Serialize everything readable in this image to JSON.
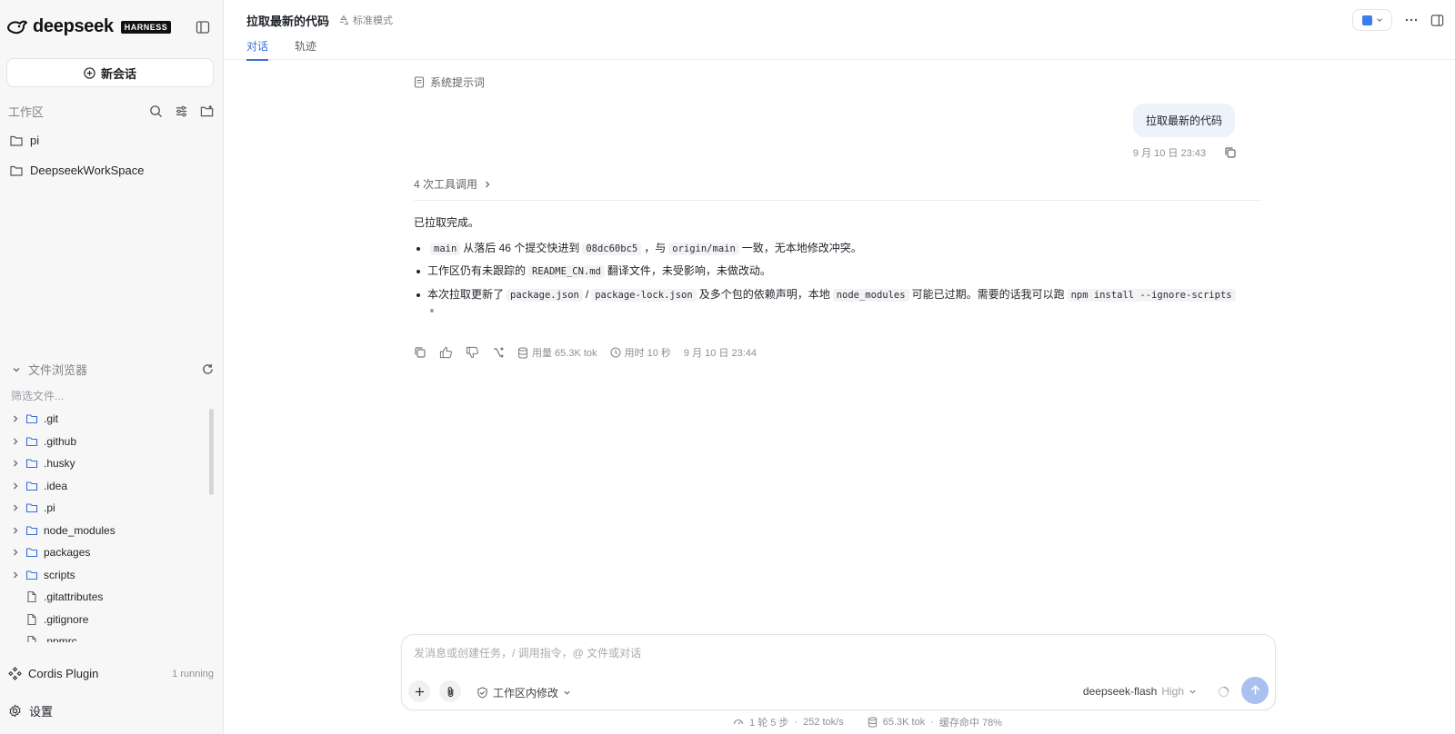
{
  "sidebar": {
    "brand": "deepseek",
    "badge": "HARNESS",
    "new_chat_label": "新会话",
    "workspace_label": "工作区",
    "workspaces": [
      "pi",
      "DeepseekWorkSpace"
    ],
    "file_browser_label": "文件浏览器",
    "filter_placeholder": "筛选文件...",
    "tree": [
      {
        "name": ".git",
        "type": "folder"
      },
      {
        "name": ".github",
        "type": "folder"
      },
      {
        "name": ".husky",
        "type": "folder"
      },
      {
        "name": ".idea",
        "type": "folder"
      },
      {
        "name": ".pi",
        "type": "folder"
      },
      {
        "name": "node_modules",
        "type": "folder"
      },
      {
        "name": "packages",
        "type": "folder"
      },
      {
        "name": "scripts",
        "type": "folder"
      },
      {
        "name": ".gitattributes",
        "type": "file"
      },
      {
        "name": ".gitignore",
        "type": "file"
      },
      {
        "name": ".npmrc",
        "type": "file"
      }
    ],
    "plugin_label": "Cordis Plugin",
    "plugin_status": "1 running",
    "settings_label": "设置"
  },
  "header": {
    "title": "拉取最新的代码",
    "mode": "标准模式",
    "tabs": [
      {
        "label": "对话",
        "active": true
      },
      {
        "label": "轨迹",
        "active": false
      }
    ]
  },
  "conversation": {
    "system_prompt_label": "系统提示词",
    "user_message": "拉取最新的代码",
    "user_time": "9 月 10 日 23:43",
    "tool_calls_label": "4 次工具调用",
    "reply_intro": "已拉取完成。",
    "bullets": [
      {
        "parts": [
          {
            "code": "main"
          },
          {
            "text": "从落后 46 个提交快进到"
          },
          {
            "code": "08dc60bc5"
          },
          {
            "text": "，与"
          },
          {
            "code": "origin/main"
          },
          {
            "text": "一致，无本地修改冲突。"
          }
        ]
      },
      {
        "parts": [
          {
            "text": "工作区仍有未跟踪的"
          },
          {
            "code": "README_CN.md"
          },
          {
            "text": "翻译文件，未受影响，未做改动。"
          }
        ]
      },
      {
        "parts": [
          {
            "text": "本次拉取更新了"
          },
          {
            "code": "package.json"
          },
          {
            "text": "/"
          },
          {
            "code": "package-lock.json"
          },
          {
            "text": "及多个包的依赖声明，本地"
          },
          {
            "code": "node_modules"
          },
          {
            "text": "可能已过期。需要的话我可以跑"
          },
          {
            "code": "npm install --ignore-scripts"
          }
        ]
      }
    ],
    "usage": "用量 65.3K tok",
    "duration": "用时 10 秒",
    "reply_time": "9 月 10 日 23:44"
  },
  "composer": {
    "placeholder": "发消息或创建任务，/ 调用指令，@ 文件或对话",
    "scope_label": "工作区内修改",
    "model": "deepseek-flash",
    "level": "High"
  },
  "footer": {
    "turns": "1 轮 5 步",
    "speed": "252 tok/s",
    "tokens": "65.3K tok",
    "cache": "缓存命中 78%"
  },
  "colors": {
    "accent": "#3a6fd8",
    "send": "#a9c0f0",
    "bubble": "#eef2fb",
    "sidebar_bg": "#f7f7f8"
  }
}
